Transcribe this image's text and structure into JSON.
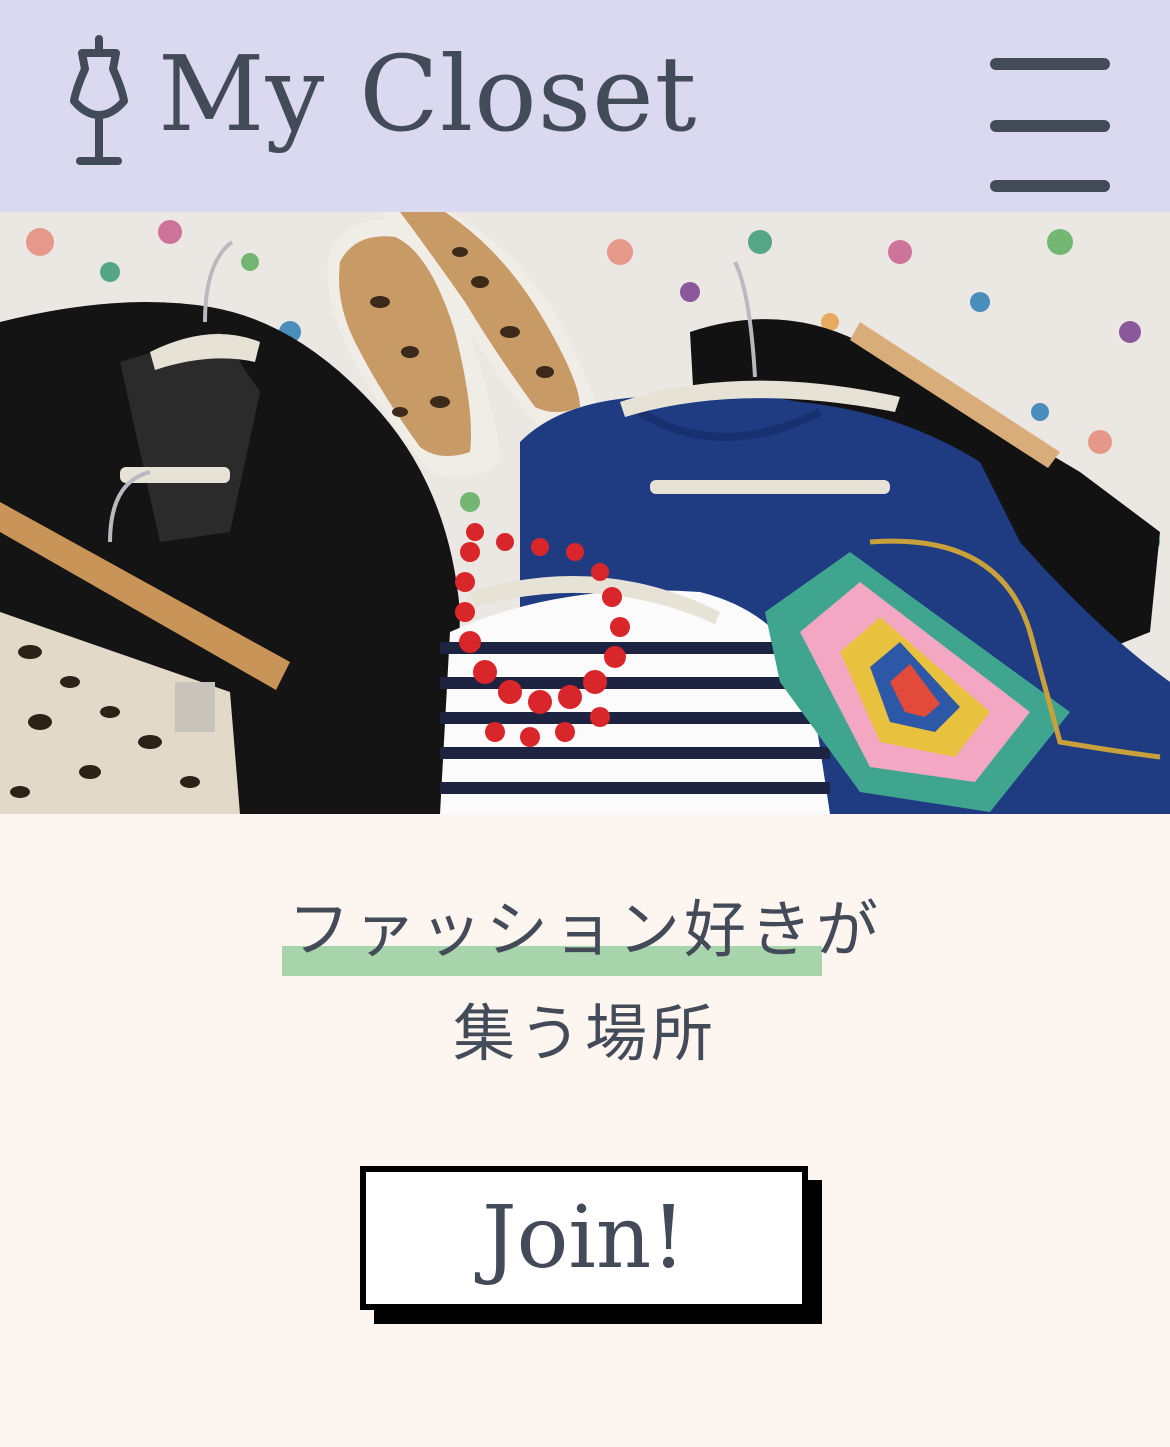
{
  "header": {
    "brand": "My Closet",
    "logo_icon": "mannequin-icon",
    "menu_icon": "hamburger-menu-icon"
  },
  "hero": {
    "image": "clothing-flatlay-photo"
  },
  "tagline": {
    "line1_highlight": "ファッション好き",
    "line1_rest": "が",
    "line2": "集う場所",
    "highlight_color": "#a8d4ac"
  },
  "cta": {
    "label": "Join!"
  },
  "colors": {
    "header_bg": "#dbd9f0",
    "page_bg": "#fdf5f0",
    "text": "#434a58",
    "button_border": "#000000"
  }
}
